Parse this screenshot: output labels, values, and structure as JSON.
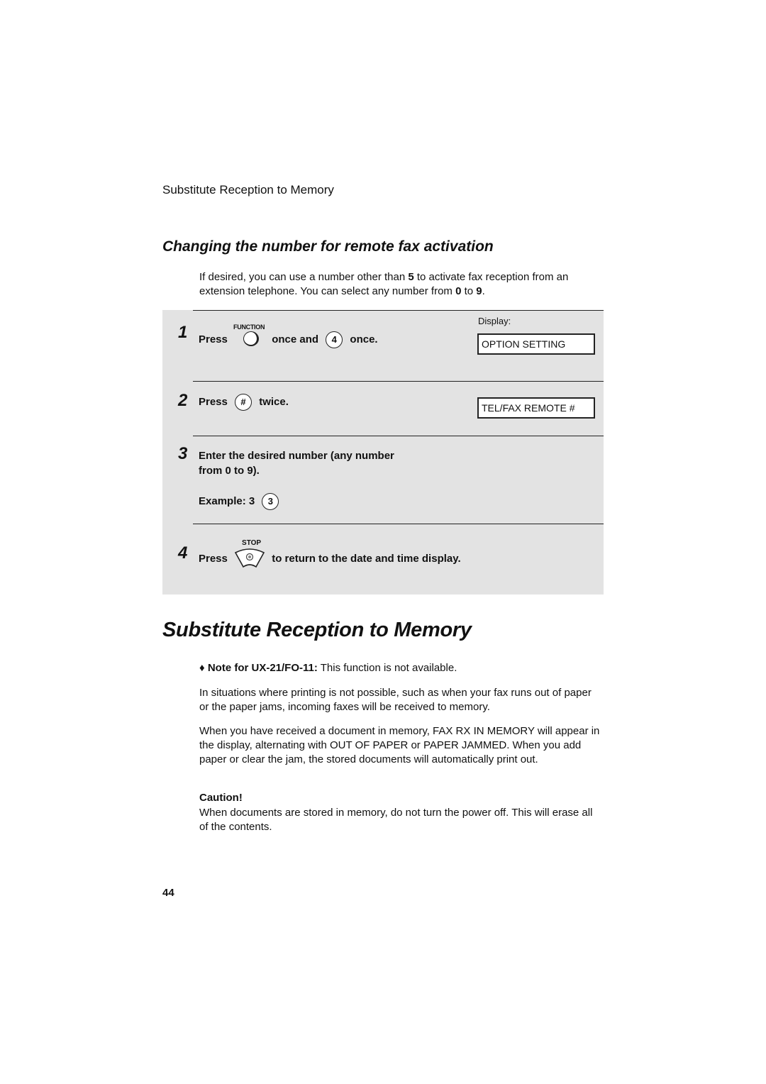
{
  "running_head": "Substitute Reception to Memory",
  "section": {
    "heading": "Changing the number for remote fax activation",
    "intro": {
      "part1": "If desired, you can use a number other than ",
      "bold1": "5",
      "part2": " to activate fax reception from an extension telephone. You can select any number from ",
      "bold2": "0",
      "part3": " to ",
      "bold3": "9",
      "part4": "."
    },
    "display_label": "Display:",
    "steps": [
      {
        "number": "1",
        "press": "Press",
        "key1_label": "FUNCTION",
        "mid": "once and",
        "key2": "4",
        "end": "once.",
        "display": "OPTION SETTING"
      },
      {
        "number": "2",
        "press": "Press",
        "key": "#",
        "end": "twice.",
        "display": "TEL/FAX REMOTE #"
      },
      {
        "number": "3",
        "line1": "Enter the desired number (any number",
        "line2": "from 0 to 9).",
        "example_label": "Example: 3",
        "example_key": "3"
      },
      {
        "number": "4",
        "press": "Press",
        "key_label": "STOP",
        "end": "to return to the date and time display."
      }
    ]
  },
  "main": {
    "heading": "Substitute Reception to Memory",
    "note_bullet": "♦",
    "note_bold": "Note for UX-21/FO-11:",
    "note_text": " This function is not available.",
    "paragraph1": "In situations where printing is not possible, such as when your fax runs out of paper or the paper jams, incoming faxes will be received to memory.",
    "paragraph2": "When you have received a document in memory, FAX RX IN MEMORY will appear in the display, alternating with OUT OF PAPER or PAPER JAMMED. When you add paper or clear the jam, the stored documents will automatically print out.",
    "caution_title": "Caution!",
    "caution_text": "When documents are stored in memory, do not turn the power off. This will erase all of the contents."
  },
  "page_number": "44"
}
